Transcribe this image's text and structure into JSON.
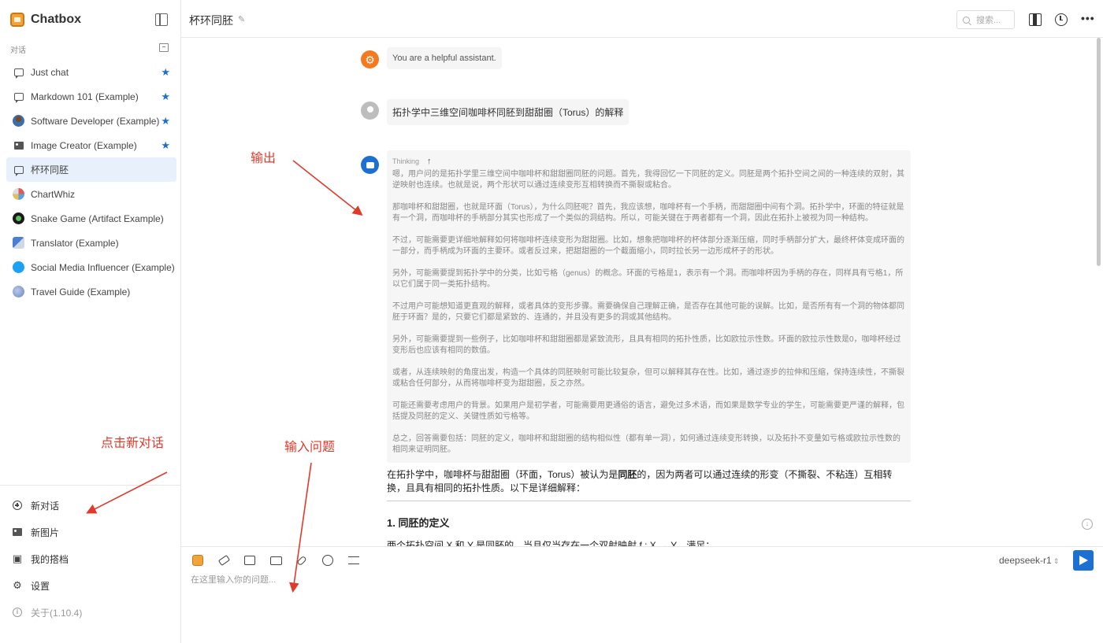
{
  "app": {
    "title": "Chatbox"
  },
  "sidebar": {
    "section_label": "对话",
    "conversations": [
      {
        "label": "Just chat",
        "icon": "chat-bubble-icon",
        "starred": true
      },
      {
        "label": "Markdown 101 (Example)",
        "icon": "chat-bubble-icon",
        "starred": true
      },
      {
        "label": "Software Developer (Example)",
        "icon": "developer-avatar-icon",
        "starred": true
      },
      {
        "label": "Image Creator (Example)",
        "icon": "image-icon",
        "starred": true
      },
      {
        "label": "杯环同胚",
        "icon": "chat-bubble-icon",
        "starred": false,
        "active": true
      },
      {
        "label": "ChartWhiz",
        "icon": "chart-avatar-icon",
        "starred": false
      },
      {
        "label": "Snake Game (Artifact Example)",
        "icon": "snake-avatar-icon",
        "starred": false
      },
      {
        "label": "Translator (Example)",
        "icon": "translator-avatar-icon",
        "starred": false
      },
      {
        "label": "Social Media Influencer (Example)",
        "icon": "twitter-avatar-icon",
        "starred": false
      },
      {
        "label": "Travel Guide (Example)",
        "icon": "globe-avatar-icon",
        "starred": false
      }
    ],
    "bottom": {
      "new_chat": "新对话",
      "new_image": "新图片",
      "my_partners": "我的搭档",
      "settings": "设置",
      "about": "关于(1.10.4)"
    }
  },
  "header": {
    "title": "杯环同胚",
    "search_placeholder": "搜索..."
  },
  "messages": {
    "system": "You are a helpful assistant.",
    "user": "拓扑学中三维空间咖啡杯同胚到甜甜圈（Torus）的解释",
    "thinking_label": "Thinking",
    "thinking_paragraphs": [
      "嗯，用户问的是拓扑学里三维空间中咖啡杯和甜甜圈同胚的问题。首先，我得回忆一下同胚的定义。同胚是两个拓扑空间之间的一种连续的双射，其逆映射也连续。也就是说，两个形状可以通过连续变形互相转换而不撕裂或粘合。",
      "那咖啡杯和甜甜圈，也就是环面（Torus），为什么同胚呢？首先，我应该想，咖啡杯有一个手柄，而甜甜圈中间有个洞。拓扑学中，环面的特征就是有一个洞，而咖啡杯的手柄部分其实也形成了一个类似的洞结构。所以，可能关键在于两者都有一个洞，因此在拓扑上被视为同一种结构。",
      "不过，可能需要更详细地解释如何将咖啡杯连续变形为甜甜圈。比如，想象把咖啡杯的杯体部分逐渐压缩，同时手柄部分扩大，最终杯体变成环面的一部分，而手柄成为环面的主要环。或者反过来，把甜甜圈的一个截面缩小，同时拉长另一边形成杯子的形状。",
      "另外，可能需要提到拓扑学中的分类，比如亏格（genus）的概念。环面的亏格是1，表示有一个洞。而咖啡杯因为手柄的存在，同样具有亏格1，所以它们属于同一类拓扑结构。",
      "不过用户可能想知道更直观的解释，或者具体的变形步骤。需要确保自己理解正确，是否存在其他可能的误解。比如，是否所有有一个洞的物体都同胚于环面？是的，只要它们都是紧致的、连通的，并且没有更多的洞或其他结构。",
      "另外，可能需要提到一些例子，比如咖啡杯和甜甜圈都是紧致流形，且具有相同的拓扑性质，比如欧拉示性数。环面的欧拉示性数是0，咖啡杯经过变形后也应该有相同的数值。",
      "或者，从连续映射的角度出发，构造一个具体的同胚映射可能比较复杂，但可以解释其存在性。比如，通过逐步的拉伸和压缩，保持连续性，不撕裂或粘合任何部分，从而将咖啡杯变为甜甜圈，反之亦然。",
      "可能还需要考虑用户的背景。如果用户是初学者，可能需要用更通俗的语言，避免过多术语，而如果是数学专业的学生，可能需要更严谨的解释，包括提及同胚的定义、关键性质如亏格等。",
      "总之，回答需要包括：同胚的定义，咖啡杯和甜甜圈的结构相似性（都有单一洞），如何通过连续变形转换，以及拓扑不变量如亏格或欧拉示性数的相同来证明同胚。"
    ],
    "answer_pre": "在拓扑学中，咖啡杯与甜甜圈（环面，Torus）被认为是",
    "answer_bold": "同胚",
    "answer_post": "的，因为两者可以通过连续的形变（不撕裂、不粘连）互相转换，且具有相同的拓扑性质。以下是详细解释：",
    "answer_heading": "1. 同胚的定义",
    "answer_more": "两个拓扑空间 X 和 Y 是同胚的，当且仅当存在一个双射映射 f : X → Y，满足："
  },
  "input": {
    "placeholder": "在这里输入你的问题...",
    "model": "deepseek-r1"
  },
  "annotations": {
    "output": "输出",
    "click_new": "点击新对话",
    "input_question": "输入问题"
  },
  "colors": {
    "accent": "#1d6fd2",
    "annotation": "#e03a2c",
    "system_avatar": "#f47a1f"
  }
}
